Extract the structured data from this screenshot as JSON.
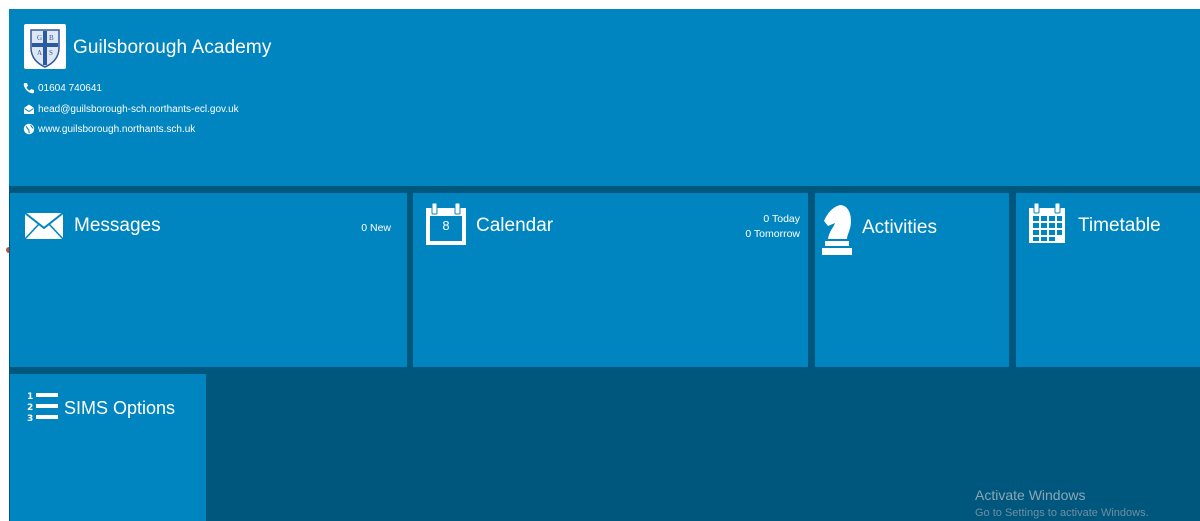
{
  "header": {
    "school_name": "Guilsborough Academy",
    "phone": "01604 740641",
    "email": "head@guilsborough-sch.northants-ecl.gov.uk",
    "website": "www.guilsborough.northants.sch.uk",
    "logo_icon": "school-crest-icon"
  },
  "tiles": {
    "messages": {
      "label": "Messages",
      "count": "0 New",
      "icon": "envelope-icon"
    },
    "calendar": {
      "label": "Calendar",
      "day": "8",
      "today": "0 Today",
      "tomorrow": "0 Tomorrow",
      "icon": "calendar-icon"
    },
    "activities": {
      "label": "Activities",
      "icon": "chess-knight-icon"
    },
    "timetable": {
      "label": "Timetable",
      "icon": "timetable-grid-icon"
    },
    "sims": {
      "label": "SIMS Options",
      "icon": "numbered-list-icon"
    }
  },
  "watermark": {
    "title": "Activate Windows",
    "subtitle": "Go to Settings to activate Windows."
  },
  "colors": {
    "tile": "#0085c0",
    "background": "#00577d",
    "text": "#ffffff"
  }
}
